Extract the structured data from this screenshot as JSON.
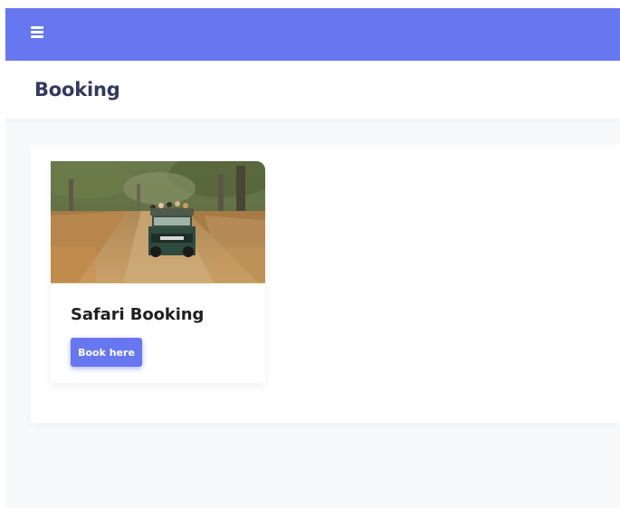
{
  "topbar": {
    "menu_icon": "hamburger-menu-icon",
    "accent_color": "#6777ef"
  },
  "header": {
    "title": "Booking"
  },
  "main": {
    "cards": [
      {
        "image_icon": "safari-jeep-photo",
        "title": "Safari Booking",
        "button_label": "Book here"
      }
    ]
  }
}
